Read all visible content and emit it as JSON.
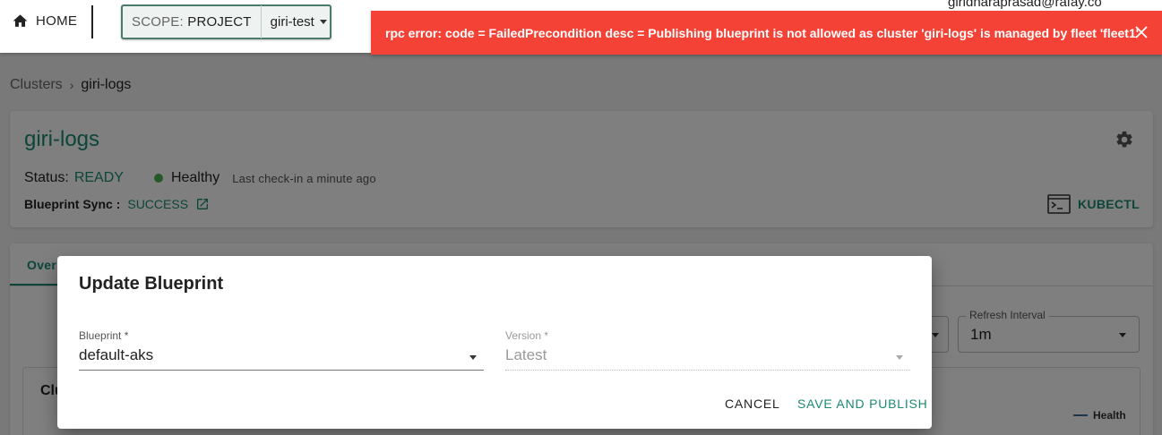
{
  "topbar": {
    "home_label": "HOME",
    "scope_label": "SCOPE:",
    "scope_value": "PROJECT",
    "project": "giri-test",
    "user": "giridharaprasad@rafay.co"
  },
  "toast": {
    "message": "rpc error: code = FailedPrecondition desc = Publishing blueprint is not allowed as cluster 'giri-logs' is managed by fleet 'fleet1'",
    "color": "#f44336"
  },
  "breadcrumb": {
    "parent": "Clusters",
    "separator": "›",
    "current": "giri-logs"
  },
  "cluster": {
    "name": "giri-logs",
    "status_label": "Status:",
    "status_value": "READY",
    "health": "Healthy",
    "last_checkin": "Last check-in a minute ago",
    "sync_label": "Blueprint Sync :",
    "sync_value": "SUCCESS",
    "kubectl_label": "KUBECTL"
  },
  "background": {
    "tab_partial": "Over",
    "refresh_label": "Refresh Interval",
    "refresh_value": "1m",
    "section_partial": "Clu",
    "legend_label": "Health"
  },
  "dialog": {
    "title": "Update Blueprint",
    "blueprint_label": "Blueprint *",
    "blueprint_value": "default-aks",
    "version_label": "Version *",
    "version_value": "Latest",
    "cancel_label": "CANCEL",
    "save_label": "SAVE AND PUBLISH"
  },
  "colors": {
    "accent": "#1b8a73",
    "error": "#f44336",
    "healthy_dot": "#4caf50"
  }
}
